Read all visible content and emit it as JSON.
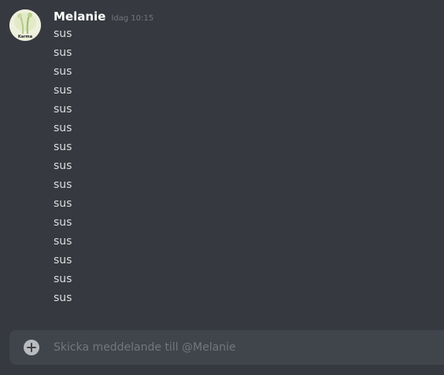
{
  "message_group": {
    "author": "Melanie",
    "timestamp": "Idag 10:15",
    "avatar_caption": "Karma",
    "messages": [
      "sus",
      "sus",
      "sus",
      "sus",
      "sus",
      "sus",
      "sus",
      "sus",
      "sus",
      "sus",
      "sus",
      "sus",
      "sus",
      "sus",
      "sus"
    ]
  },
  "composer": {
    "placeholder": "Skicka meddelande till @Melanie",
    "value": "",
    "attach_icon": "plus-circle-icon"
  },
  "colors": {
    "background": "#36393f",
    "composer_background": "#40444b",
    "username": "#ffffff",
    "message_text": "#dcddde",
    "muted_text": "#72767d",
    "icon": "#b9bbbe"
  }
}
